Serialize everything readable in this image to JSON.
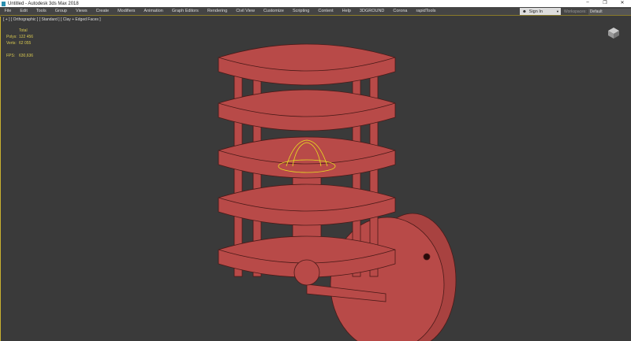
{
  "window": {
    "title": "Untitled - Autodesk 3ds Max 2018",
    "minimize": "–",
    "restore": "❐",
    "close": "✕"
  },
  "menu": [
    "File",
    "Edit",
    "Tools",
    "Group",
    "Views",
    "Create",
    "Modifiers",
    "Animation",
    "Graph Editors",
    "Rendering",
    "Civil View",
    "Customize",
    "Scripting",
    "Content",
    "Help",
    "3DGROUND",
    "Corona",
    "rapidTools"
  ],
  "signin": {
    "label": "Sign In",
    "icon": "user-icon"
  },
  "workspaces": {
    "label": "Workspaces:",
    "value": "Default"
  },
  "viewport": {
    "label": "[ + ] [ Orthographic ] [ Standard ] [ Clay + Edged Faces ]",
    "stats": {
      "header": "Total",
      "polys_label": "Polys:",
      "polys": "122 456",
      "verts_label": "Verts:",
      "verts": "62 055",
      "fps_label": "FPS:",
      "fps": "630,636"
    }
  },
  "colors": {
    "model": "#b84a48",
    "edge": "#4a1a18",
    "selection": "#e8e020",
    "border": "#c8b030"
  }
}
